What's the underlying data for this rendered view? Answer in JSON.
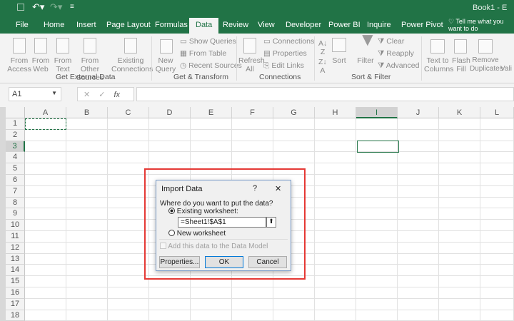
{
  "titlebar": {
    "title": "Book1 - E"
  },
  "tabs": [
    "File",
    "Home",
    "Insert",
    "Page Layout",
    "Formulas",
    "Data",
    "Review",
    "View",
    "Developer",
    "Power BI",
    "Inquire",
    "Power Pivot"
  ],
  "active_tab": "Data",
  "tell_me": "Tell me what you want to do",
  "ribbon": {
    "groups": [
      {
        "label": "Get External Data",
        "items": [
          "From Access",
          "From Web",
          "From Text",
          "From Other Sources",
          "Existing Connections"
        ]
      },
      {
        "label": "Get & Transform",
        "items": [
          "New Query",
          "Show Queries",
          "From Table",
          "Recent Sources"
        ]
      },
      {
        "label": "Connections",
        "items": [
          "Refresh All",
          "Connections",
          "Properties",
          "Edit Links"
        ]
      },
      {
        "label": "Sort & Filter",
        "items": [
          "Sort",
          "Filter",
          "Clear",
          "Reapply",
          "Advanced"
        ]
      },
      {
        "label": "",
        "items": [
          "Text to Columns",
          "Flash Fill",
          "Remove Duplicates",
          "Vali"
        ]
      }
    ]
  },
  "formula_bar": {
    "name_box": "A1",
    "fx": "fx",
    "value": ""
  },
  "columns": [
    "A",
    "B",
    "C",
    "D",
    "E",
    "F",
    "G",
    "H",
    "I",
    "J",
    "K",
    "L"
  ],
  "rows": [
    "1",
    "2",
    "3",
    "4",
    "5",
    "6",
    "7",
    "8",
    "9",
    "10",
    "11",
    "12",
    "13",
    "14",
    "15",
    "16",
    "17",
    "18"
  ],
  "dialog": {
    "title": "Import Data",
    "help": "?",
    "close": "✕",
    "prompt": "Where do you want to put the data?",
    "existing": "Existing worksheet:",
    "range": "=Sheet1!$A$1",
    "new": "New worksheet",
    "data_model": "Add this data to the Data Model",
    "properties": "Properties...",
    "ok": "OK",
    "cancel": "Cancel",
    "selected_option": "existing"
  },
  "colors": {
    "accent": "#217346",
    "highlight": "#e53935"
  }
}
